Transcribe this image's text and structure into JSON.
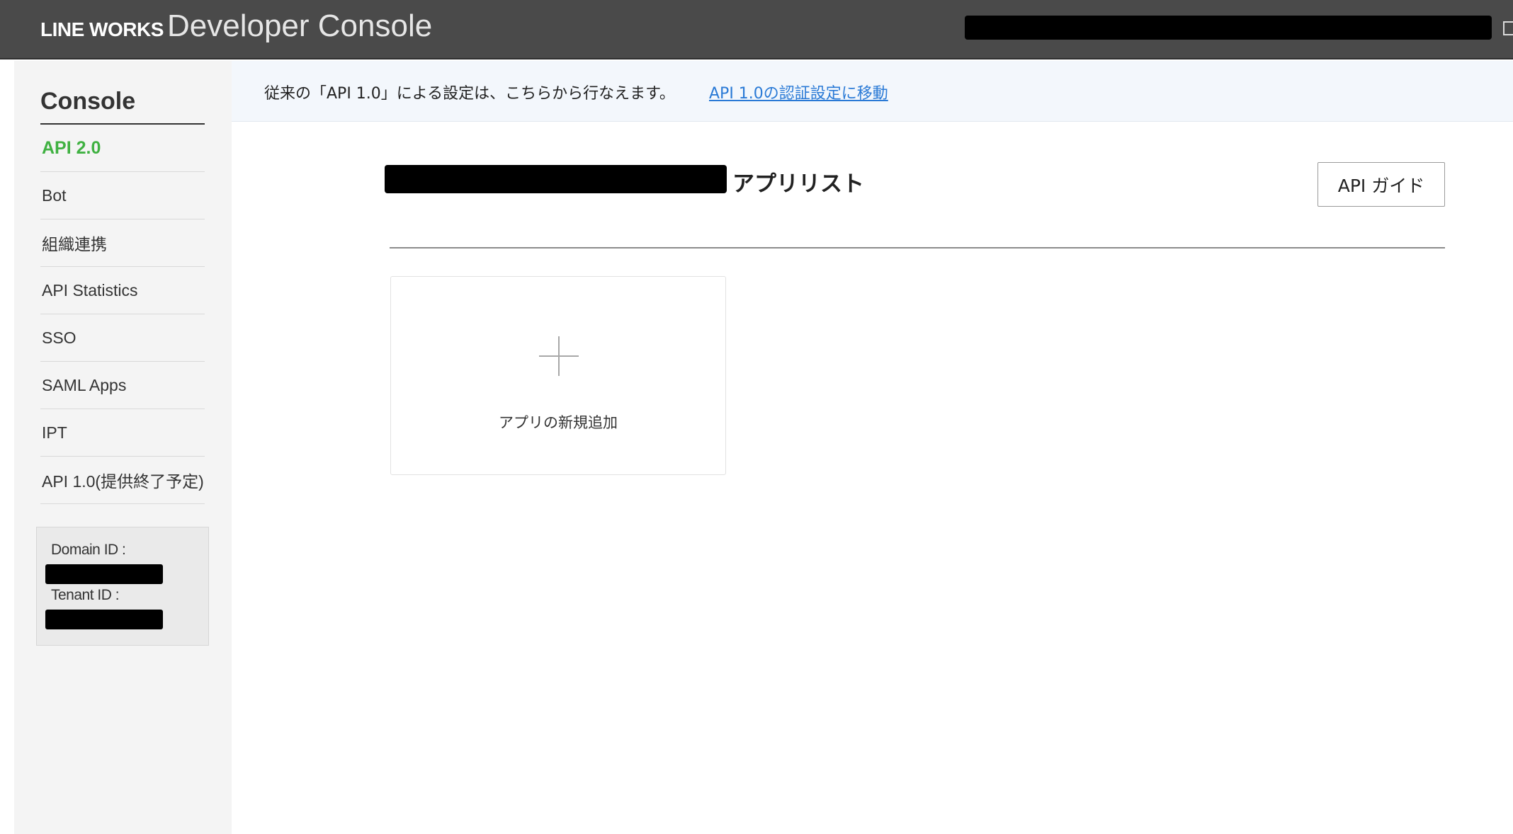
{
  "header": {
    "logo": "LINE WORKS",
    "product": "Developer Console"
  },
  "sidebar": {
    "title": "Console",
    "items": [
      {
        "label": "API 2.0"
      },
      {
        "label": "Bot"
      },
      {
        "label": "組織連携"
      },
      {
        "label": "API Statistics"
      },
      {
        "label": "SSO"
      },
      {
        "label": "SAML Apps"
      },
      {
        "label": "IPT"
      },
      {
        "label": "API 1.0(提供終了予定)"
      }
    ],
    "active_index": 0,
    "domain_id_label": "Domain ID :",
    "tenant_id_label": "Tenant ID :"
  },
  "notice": {
    "text": "従来の「API 1.0」による設定は、こちらから行なえます。",
    "link": "API 1.0の認証設定に移動"
  },
  "main": {
    "title": "アプリリスト",
    "guide_button": "API ガイド",
    "add_app_label": "アプリの新規追加"
  },
  "colors": {
    "header_bg": "#4a4a4a",
    "active_nav": "#3fb141",
    "link": "#2a7ad6",
    "sidebar_bg": "#f4f4f4",
    "notice_bg": "#f3f7fc"
  },
  "icons": {
    "add": "plus-icon"
  }
}
